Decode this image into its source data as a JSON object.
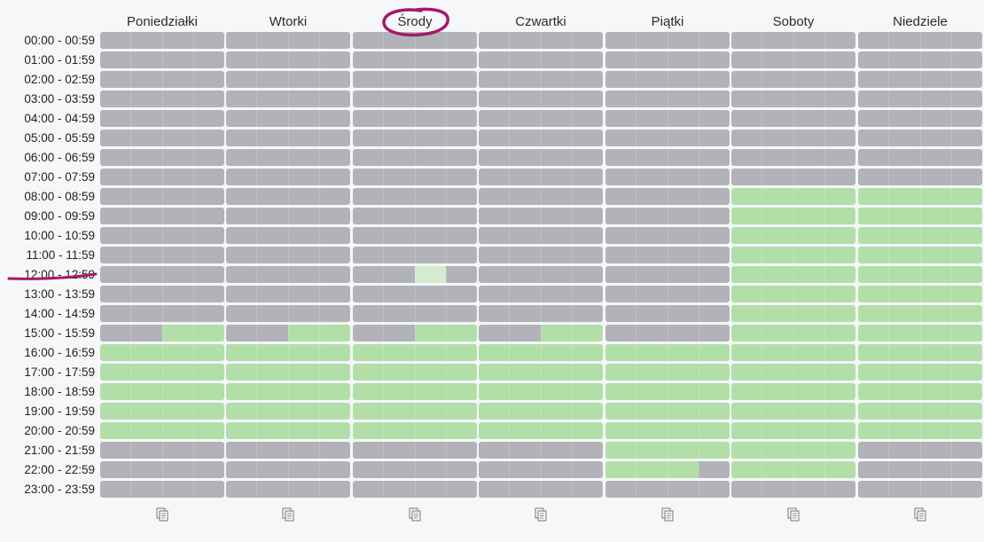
{
  "days": [
    "Poniedziałki",
    "Wtorki",
    "Środy",
    "Czwartki",
    "Piątki",
    "Soboty",
    "Niedziele"
  ],
  "hours": [
    "00:00 - 00:59",
    "01:00 - 01:59",
    "02:00 - 02:59",
    "03:00 - 03:59",
    "04:00 - 04:59",
    "05:00 - 05:59",
    "06:00 - 06:59",
    "07:00 - 07:59",
    "08:00 - 08:59",
    "09:00 - 09:59",
    "10:00 - 10:59",
    "11:00 - 11:59",
    "12:00 - 12:59",
    "13:00 - 13:59",
    "14:00 - 14:59",
    "15:00 - 15:59",
    "16:00 - 16:59",
    "17:00 - 17:59",
    "18:00 - 18:59",
    "19:00 - 19:59",
    "20:00 - 20:59",
    "21:00 - 21:59",
    "22:00 - 22:59",
    "23:00 - 23:59"
  ],
  "segments_per_hour": 4,
  "colors": {
    "inactive": "#b1b3b8",
    "active": "#b2dfa7",
    "highlight": "#d3ecd0",
    "annotation": "#a3196b",
    "icon": "#777777"
  },
  "schedule": [
    {
      "full": [
        16,
        17,
        18,
        19,
        20
      ],
      "partial": {
        "15": [
          "off",
          "off",
          "on",
          "on"
        ]
      }
    },
    {
      "full": [
        16,
        17,
        18,
        19,
        20
      ],
      "partial": {
        "15": [
          "off",
          "off",
          "on",
          "on"
        ]
      }
    },
    {
      "full": [
        16,
        17,
        18,
        19,
        20
      ],
      "partial": {
        "15": [
          "off",
          "off",
          "on",
          "on"
        ],
        "12": [
          "off",
          "off",
          "hl",
          "off"
        ]
      }
    },
    {
      "full": [
        16,
        17,
        18,
        19,
        20
      ],
      "partial": {
        "15": [
          "off",
          "off",
          "on",
          "on"
        ]
      }
    },
    {
      "full": [
        16,
        17,
        18,
        19,
        20,
        21
      ],
      "partial": {
        "22": [
          "on",
          "on",
          "on",
          "off"
        ]
      }
    },
    {
      "full": [
        8,
        9,
        10,
        11,
        12,
        13,
        14,
        15,
        16,
        17,
        18,
        19,
        20,
        21,
        22
      ],
      "partial": {}
    },
    {
      "full": [
        8,
        9,
        10,
        11,
        12,
        13,
        14,
        15,
        16,
        17,
        18,
        19,
        20
      ],
      "partial": {}
    }
  ],
  "copy_icon": "copy-icon"
}
